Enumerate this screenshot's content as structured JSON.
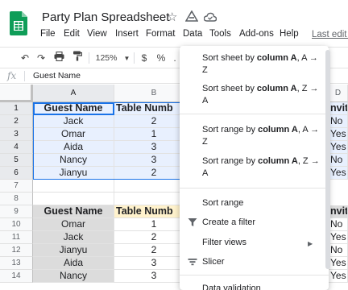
{
  "doc": {
    "title": "Party Plan Spreadsheet"
  },
  "menu": {
    "items": [
      "File",
      "Edit",
      "View",
      "Insert",
      "Format",
      "Data",
      "Tools",
      "Add-ons",
      "Help"
    ],
    "active": "Data",
    "last_edit": "Last edit w"
  },
  "toolbar": {
    "zoom": "125%",
    "currency": "$",
    "percent": "%",
    "decimal": "."
  },
  "formula_bar": {
    "fx": "fx",
    "value": "Guest Name"
  },
  "columns": [
    "A",
    "B",
    "D"
  ],
  "rows": [
    "1",
    "2",
    "3",
    "4",
    "5",
    "6",
    "7",
    "8",
    "9",
    "10",
    "11",
    "12",
    "13",
    "14"
  ],
  "sheet": {
    "table1": {
      "headers": [
        "Guest Name",
        "Table Numb"
      ],
      "rows": [
        [
          "Jack",
          "2"
        ],
        [
          "Omar",
          "1"
        ],
        [
          "Aida",
          "3"
        ],
        [
          "Nancy",
          "3"
        ],
        [
          "Jianyu",
          "2"
        ]
      ]
    },
    "table2": {
      "headers": [
        "Guest Name",
        "Table Numb"
      ],
      "rows": [
        [
          "Omar",
          "1"
        ],
        [
          "Jack",
          "2"
        ],
        [
          "Jianyu",
          "2"
        ],
        [
          "Aida",
          "3"
        ],
        [
          "Nancy",
          "3"
        ]
      ]
    },
    "colD_header": "nvita",
    "colD_values": [
      "No",
      "Yes",
      "Yes",
      "No",
      "Yes"
    ],
    "colD2_header": "nvita",
    "colD2_values": [
      "No",
      "Yes",
      "No",
      "Yes",
      "Yes"
    ]
  },
  "data_menu": {
    "sort_sheet_az": {
      "prefix": "Sort sheet by ",
      "bold": "column A",
      "suffix": ", A → Z"
    },
    "sort_sheet_za": {
      "prefix": "Sort sheet by ",
      "bold": "column A",
      "suffix": ", Z → A"
    },
    "sort_range_az": {
      "prefix": "Sort range by ",
      "bold": "column A",
      "suffix": ", A → Z"
    },
    "sort_range_za": {
      "prefix": "Sort range by ",
      "bold": "column A",
      "suffix": ", Z → A"
    },
    "sort_range": "Sort range",
    "create_filter": "Create a filter",
    "filter_views": "Filter views",
    "slicer": "Slicer",
    "data_validation": "Data validation"
  },
  "colors": {
    "selection_blue": "#1a73e8",
    "blue_fill": "#e8f0fe",
    "gray_fill": "#dcdcdc",
    "yellow_fill": "#fff2cc",
    "sheets_green": "#0f9d58"
  }
}
